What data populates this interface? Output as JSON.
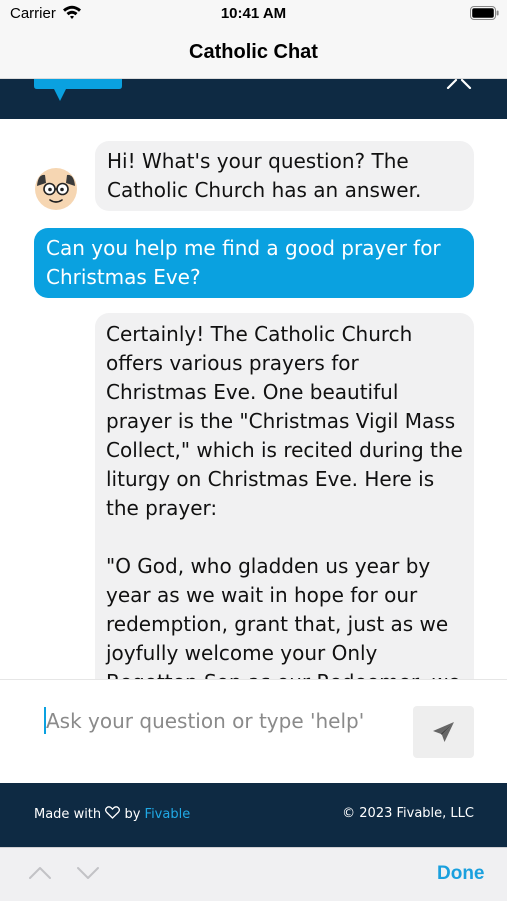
{
  "status_bar": {
    "carrier": "Carrier",
    "time": "10:41 AM",
    "icons": [
      "wifi-icon",
      "battery-icon"
    ]
  },
  "nav": {
    "title": "Catholic Chat"
  },
  "chat_header": {
    "icons": [
      "chat-tab-icon",
      "close-icon"
    ]
  },
  "messages": [
    {
      "sender": "bot",
      "paragraphs": [
        "Hi! What's your question? The Catholic Church has an answer."
      ]
    },
    {
      "sender": "user",
      "paragraphs": [
        "Can you help me find a good prayer for Christmas Eve?"
      ]
    },
    {
      "sender": "bot",
      "paragraphs": [
        "Certainly! The Catholic Church offers various prayers for Christmas Eve. One beautiful prayer is the \"Christmas Vigil Mass Collect,\" which is recited during the liturgy on Christmas Eve. Here is the prayer:",
        "\"O God, who gladden us year by year as we wait in hope for our redemption, grant that, just as we joyfully welcome your Only Begotten Son as our Redeemer, we may also"
      ]
    }
  ],
  "input": {
    "placeholder": "Ask your question or type 'help'",
    "value": ""
  },
  "send_button": {
    "icon": "send-icon"
  },
  "footer": {
    "made_with": "Made with",
    "by": "by",
    "brand": "Fivable",
    "copyright": "© 2023 Fivable, LLC"
  },
  "keyboard_toolbar": {
    "done": "Done",
    "icons": [
      "chevron-up-icon",
      "chevron-down-icon"
    ]
  },
  "colors": {
    "accent": "#0aa1e0",
    "header_dark": "#0e2a43",
    "bot_bubble": "#f1f1f2",
    "link": "#20a9e6"
  }
}
